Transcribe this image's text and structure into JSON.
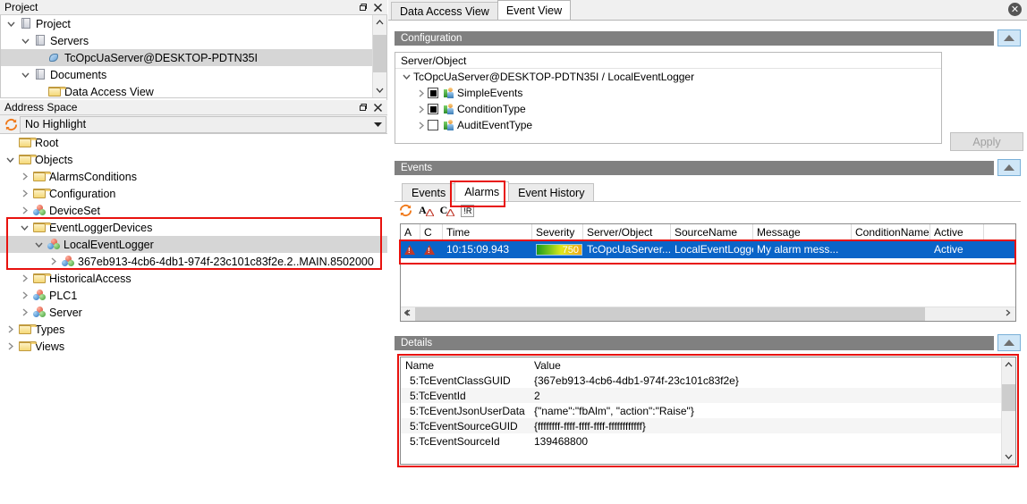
{
  "project_panel": {
    "title": "Project",
    "restore_icon": "restore-icon",
    "close_icon": "close-icon",
    "tree": [
      {
        "label": "Project",
        "icon": "document-icon",
        "indent": 0,
        "twist": "down",
        "selected": false
      },
      {
        "label": "Servers",
        "icon": "document-icon",
        "indent": 1,
        "twist": "down",
        "selected": false
      },
      {
        "label": "TcOpcUaServer@DESKTOP-PDTN35I",
        "icon": "plug-icon",
        "indent": 2,
        "twist": "none",
        "selected": true
      },
      {
        "label": "Documents",
        "icon": "document-icon",
        "indent": 1,
        "twist": "down",
        "selected": false
      },
      {
        "label": "Data Access View",
        "icon": "folder-icon",
        "indent": 2,
        "twist": "none",
        "selected": false
      }
    ]
  },
  "address_panel": {
    "title": "Address Space",
    "restore_icon": "restore-icon",
    "close_icon": "close-icon",
    "highlight": {
      "refresh_icon": "refresh-icon",
      "value": "No Highlight",
      "carat_icon": "chevron-down-icon"
    },
    "tree": [
      {
        "label": "Root",
        "icon": "folder-icon",
        "indent": 0,
        "twist": "none",
        "selected": false
      },
      {
        "label": "Objects",
        "icon": "folder-icon",
        "indent": 0,
        "twist": "down",
        "selected": false
      },
      {
        "label": "AlarmsConditions",
        "icon": "folder-icon",
        "indent": 1,
        "twist": "right",
        "selected": false
      },
      {
        "label": "Configuration",
        "icon": "folder-icon",
        "indent": 1,
        "twist": "right",
        "selected": false
      },
      {
        "label": "DeviceSet",
        "icon": "node-icon",
        "indent": 1,
        "twist": "right",
        "selected": false
      },
      {
        "label": "EventLoggerDevices",
        "icon": "folder-icon",
        "indent": 1,
        "twist": "down",
        "selected": false
      },
      {
        "label": "LocalEventLogger",
        "icon": "node-icon",
        "indent": 2,
        "twist": "down",
        "selected": true
      },
      {
        "label": "367eb913-4cb6-4db1-974f-23c101c83f2e.2..MAIN.8502000",
        "icon": "node-icon",
        "indent": 3,
        "twist": "right",
        "selected": false
      },
      {
        "label": "HistoricalAccess",
        "icon": "folder-icon",
        "indent": 1,
        "twist": "right",
        "selected": false
      },
      {
        "label": "PLC1",
        "icon": "node-icon",
        "indent": 1,
        "twist": "right",
        "selected": false
      },
      {
        "label": "Server",
        "icon": "node-icon",
        "indent": 1,
        "twist": "right",
        "selected": false
      },
      {
        "label": "Types",
        "icon": "folder-icon",
        "indent": 0,
        "twist": "right",
        "selected": false
      },
      {
        "label": "Views",
        "icon": "folder-icon",
        "indent": 0,
        "twist": "right",
        "selected": false
      }
    ]
  },
  "main": {
    "tabs": [
      {
        "label": "Data Access View",
        "active": false
      },
      {
        "label": "Event View",
        "active": true
      }
    ],
    "close_icon": "close-icon",
    "configuration": {
      "header": "Configuration",
      "collapse_icon": "collapse-triangle-icon",
      "column_header": "Server/Object",
      "root_label": "TcOpcUaServer@DESKTOP-PDTN35I / LocalEventLogger",
      "items": [
        {
          "label": "SimpleEvents",
          "checkbox": "partial",
          "icon": "event-type-icon",
          "twist": "right"
        },
        {
          "label": "ConditionType",
          "checkbox": "partial",
          "icon": "event-type-icon",
          "twist": "right"
        },
        {
          "label": "AuditEventType",
          "checkbox": "empty",
          "icon": "event-type-icon",
          "twist": "right"
        }
      ],
      "apply_label": "Apply",
      "apply_enabled": false
    },
    "events": {
      "header": "Events",
      "collapse_icon": "collapse-triangle-icon",
      "tabs": [
        {
          "label": "Events",
          "active": false
        },
        {
          "label": "Alarms",
          "active": true
        },
        {
          "label": "Event History",
          "active": false
        }
      ],
      "toolbar": [
        {
          "name": "refresh-icon",
          "label": ""
        },
        {
          "name": "acknowledge-alarm-icon",
          "label": "A"
        },
        {
          "name": "confirm-alarm-icon",
          "label": "C"
        },
        {
          "name": "retain-flag-button",
          "label": "!R"
        }
      ],
      "columns": [
        "A",
        "C",
        "Time",
        "Severity",
        "Server/Object",
        "SourceName",
        "Message",
        "ConditionName",
        "Active"
      ],
      "rows": [
        {
          "a_icon": "alarm-warning-icon",
          "c_icon": "condition-warning-icon",
          "time": "10:15:09.943",
          "severity": "750",
          "server_object": "TcOpcUaServer...",
          "source_name": "LocalEventLogger",
          "message": "My alarm mess...",
          "condition_name": "",
          "active": "Active",
          "selected": true
        }
      ],
      "scroll_left_icon": "chevron-left-icon",
      "scroll_right_icon": "chevron-right-icon"
    },
    "details": {
      "header": "Details",
      "collapse_icon": "collapse-triangle-icon",
      "columns": [
        "Name",
        "Value"
      ],
      "rows": [
        {
          "name": "5:TcEventClassGUID",
          "value": "{367eb913-4cb6-4db1-974f-23c101c83f2e}"
        },
        {
          "name": "5:TcEventId",
          "value": "2"
        },
        {
          "name": "5:TcEventJsonUserData",
          "value": "{\"name\":\"fbAlm\", \"action\":\"Raise\"}"
        },
        {
          "name": "5:TcEventSourceGUID",
          "value": "{ffffffff-ffff-ffff-ffff-ffffffffffff}"
        },
        {
          "name": "5:TcEventSourceId",
          "value": "139468800"
        }
      ],
      "scroll_up_icon": "chevron-up-icon",
      "scroll_down_icon": "chevron-down-icon"
    }
  },
  "annotation_color": "#e8120e"
}
